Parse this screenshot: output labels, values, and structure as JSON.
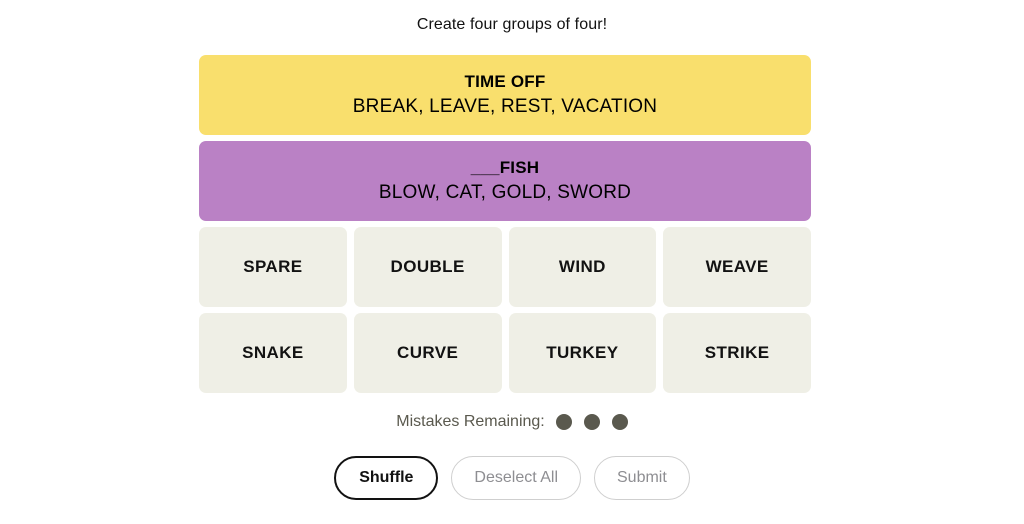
{
  "header": {
    "subtitle": "Create four groups of four!"
  },
  "board": {
    "solved_groups": [
      {
        "title": "TIME OFF",
        "members": "BREAK, LEAVE, REST, VACATION",
        "color": "#f9df6d"
      },
      {
        "title": "___FISH",
        "members": "BLOW, CAT, GOLD, SWORD",
        "color": "#ba81c5"
      }
    ],
    "tiles": [
      {
        "label": "SPARE"
      },
      {
        "label": "DOUBLE"
      },
      {
        "label": "WIND"
      },
      {
        "label": "WEAVE"
      },
      {
        "label": "SNAKE"
      },
      {
        "label": "CURVE"
      },
      {
        "label": "TURKEY"
      },
      {
        "label": "STRIKE"
      }
    ]
  },
  "mistakes": {
    "label": "Mistakes Remaining:",
    "remaining": 3,
    "dot_color": "#5a594e"
  },
  "controls": {
    "shuffle_label": "Shuffle",
    "deselect_label": "Deselect All",
    "submit_label": "Submit"
  }
}
